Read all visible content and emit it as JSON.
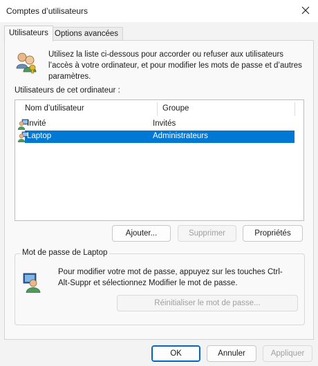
{
  "window": {
    "title": "Comptes d’utilisateurs"
  },
  "tabs": [
    {
      "label": "Utilisateurs",
      "active": true
    },
    {
      "label": "Options avancées",
      "active": false
    }
  ],
  "intro": {
    "icon": "users-icon",
    "text": "Utilisez la liste ci-dessous pour accorder ou refuser aux utilisateurs l’accès à votre ordinateur, et pour modifier les mots de passe et d’autres paramètres."
  },
  "users_list": {
    "label": "Utilisateurs de cet ordinateur :",
    "columns": [
      "Nom d’utilisateur",
      "Groupe"
    ],
    "rows": [
      {
        "name": "Invité",
        "group": "Invités",
        "selected": false,
        "icon": "user-icon"
      },
      {
        "name": "Laptop",
        "group": "Administrateurs",
        "selected": true,
        "icon": "user-icon"
      }
    ]
  },
  "list_buttons": {
    "add": "Ajouter...",
    "remove": "Supprimer",
    "properties": "Propriétés"
  },
  "password_group": {
    "title": "Mot de passe de Laptop",
    "icon": "user-monitor-icon",
    "text": "Pour modifier votre mot de passe, appuyez sur les touches Ctrl-Alt-Suppr et sélectionnez Modifier le mot de passe.",
    "reset_button": "Réinitialiser le mot de passe..."
  },
  "dialog_buttons": {
    "ok": "OK",
    "cancel": "Annuler",
    "apply": "Appliquer"
  },
  "colors": {
    "accent": "#0078d4",
    "selection_text": "#ffffff",
    "disabled_text": "#a0a0a0"
  }
}
